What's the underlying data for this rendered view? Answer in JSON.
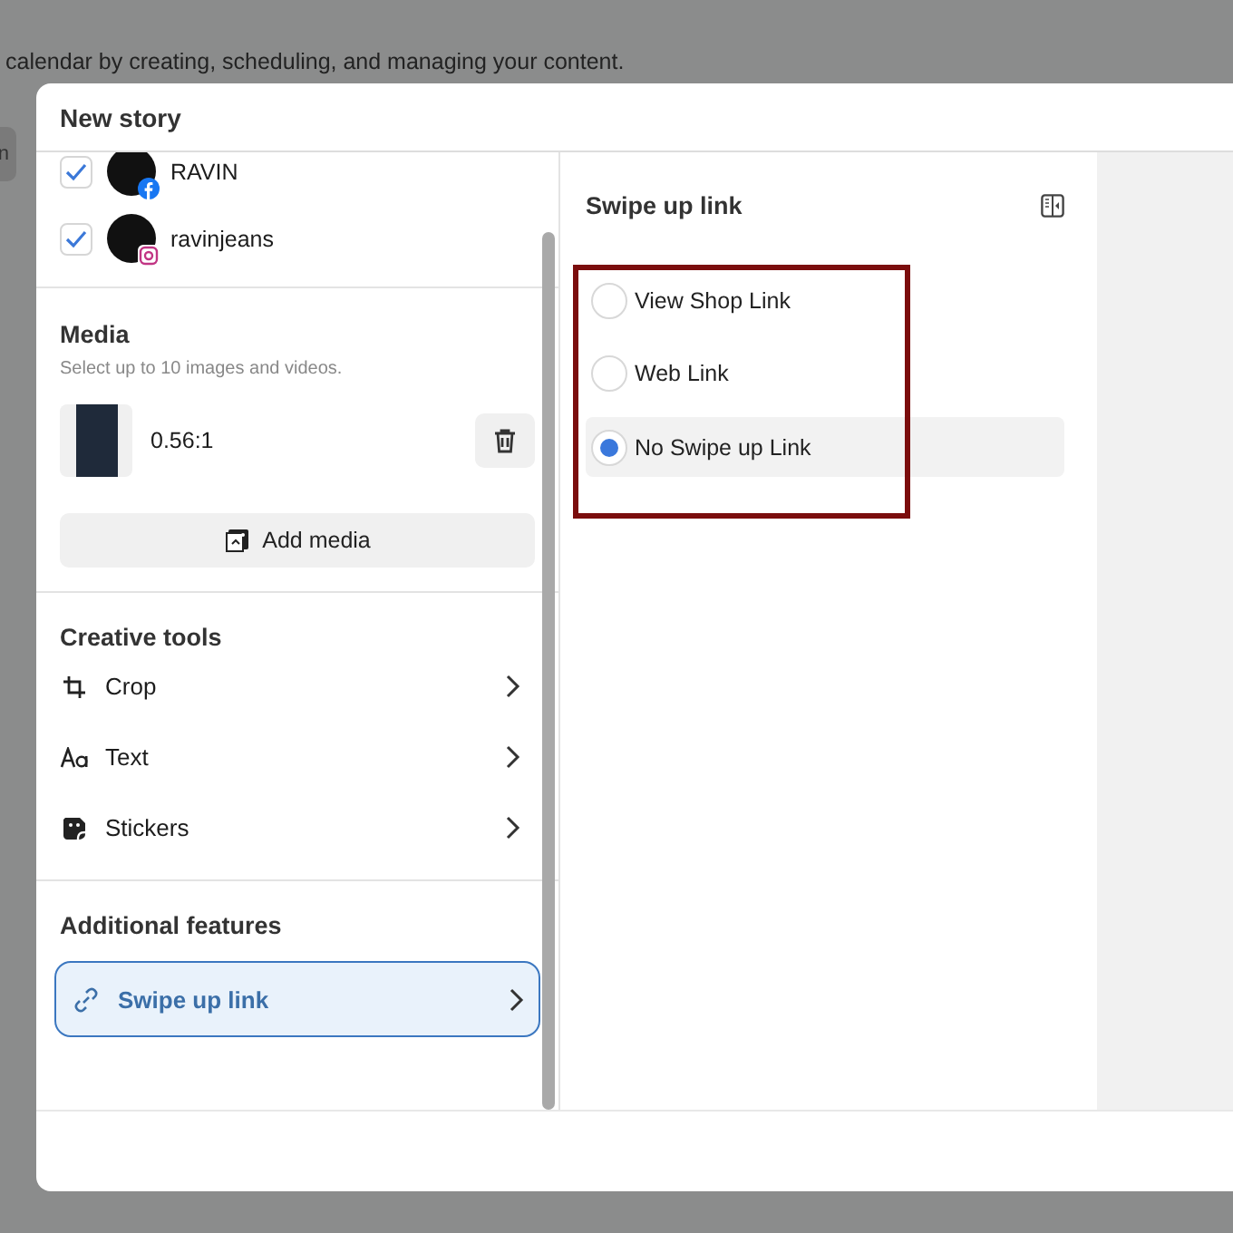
{
  "background": {
    "headline": "calendar by creating, scheduling, and managing your content.",
    "button_label": "n"
  },
  "dialog": {
    "title": "New story",
    "accounts": [
      {
        "name": "RAVIN",
        "checked": true,
        "kind": "facebook"
      },
      {
        "name": "ravinjeans",
        "checked": true,
        "kind": "instagram"
      }
    ],
    "media": {
      "title": "Media",
      "subtitle": "Select up to 10 images and videos.",
      "items": [
        {
          "ratio": "0.56:1"
        }
      ],
      "add_label": "Add media"
    },
    "creative_tools": {
      "title": "Creative tools",
      "items": [
        {
          "label": "Crop",
          "kind": "crop"
        },
        {
          "label": "Text",
          "kind": "text"
        },
        {
          "label": "Stickers",
          "kind": "stickers"
        }
      ]
    },
    "additional_features": {
      "title": "Additional features",
      "items": [
        {
          "label": "Swipe up link",
          "selected": true
        }
      ]
    },
    "swipe_panel": {
      "title": "Swipe up link",
      "options": [
        {
          "label": "View Shop Link",
          "selected": false
        },
        {
          "label": "Web Link",
          "selected": false
        },
        {
          "label": "No Swipe up Link",
          "selected": true
        }
      ]
    }
  }
}
